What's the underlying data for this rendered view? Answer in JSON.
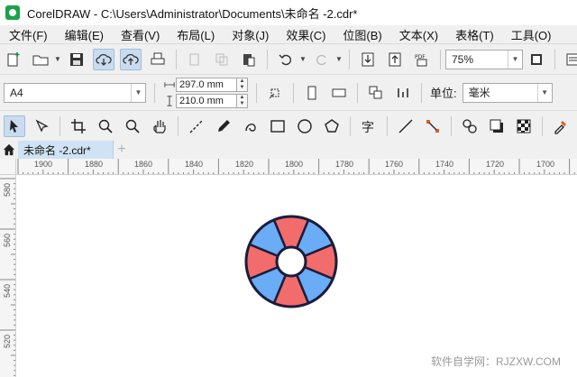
{
  "window": {
    "title": "CorelDRAW - C:\\Users\\Administrator\\Documents\\未命名 -2.cdr*"
  },
  "menu": [
    "文件(F)",
    "编辑(E)",
    "查看(V)",
    "布局(L)",
    "对象(J)",
    "效果(C)",
    "位图(B)",
    "文本(X)",
    "表格(T)",
    "工具(O)"
  ],
  "toolbar": {
    "zoom": "75%"
  },
  "property_bar": {
    "page_size": "A4",
    "width": "297.0 mm",
    "height": "210.0 mm",
    "unit_label": "单位:",
    "unit_value": "毫米"
  },
  "document_tab": {
    "name": "未命名 -2.cdr*"
  },
  "ruler": {
    "h_labels": [
      "1900",
      "1880",
      "1860",
      "1840",
      "1820",
      "1800",
      "1780",
      "1760",
      "1740",
      "1720",
      "1700"
    ],
    "v_labels": [
      "580",
      "560",
      "540",
      "520"
    ]
  },
  "drawing": {
    "fill_blue": "#6aacf5",
    "fill_red": "#f26c6c",
    "stroke": "#1c1c3c"
  },
  "watermark": "软件自学网：RJZXW.COM"
}
